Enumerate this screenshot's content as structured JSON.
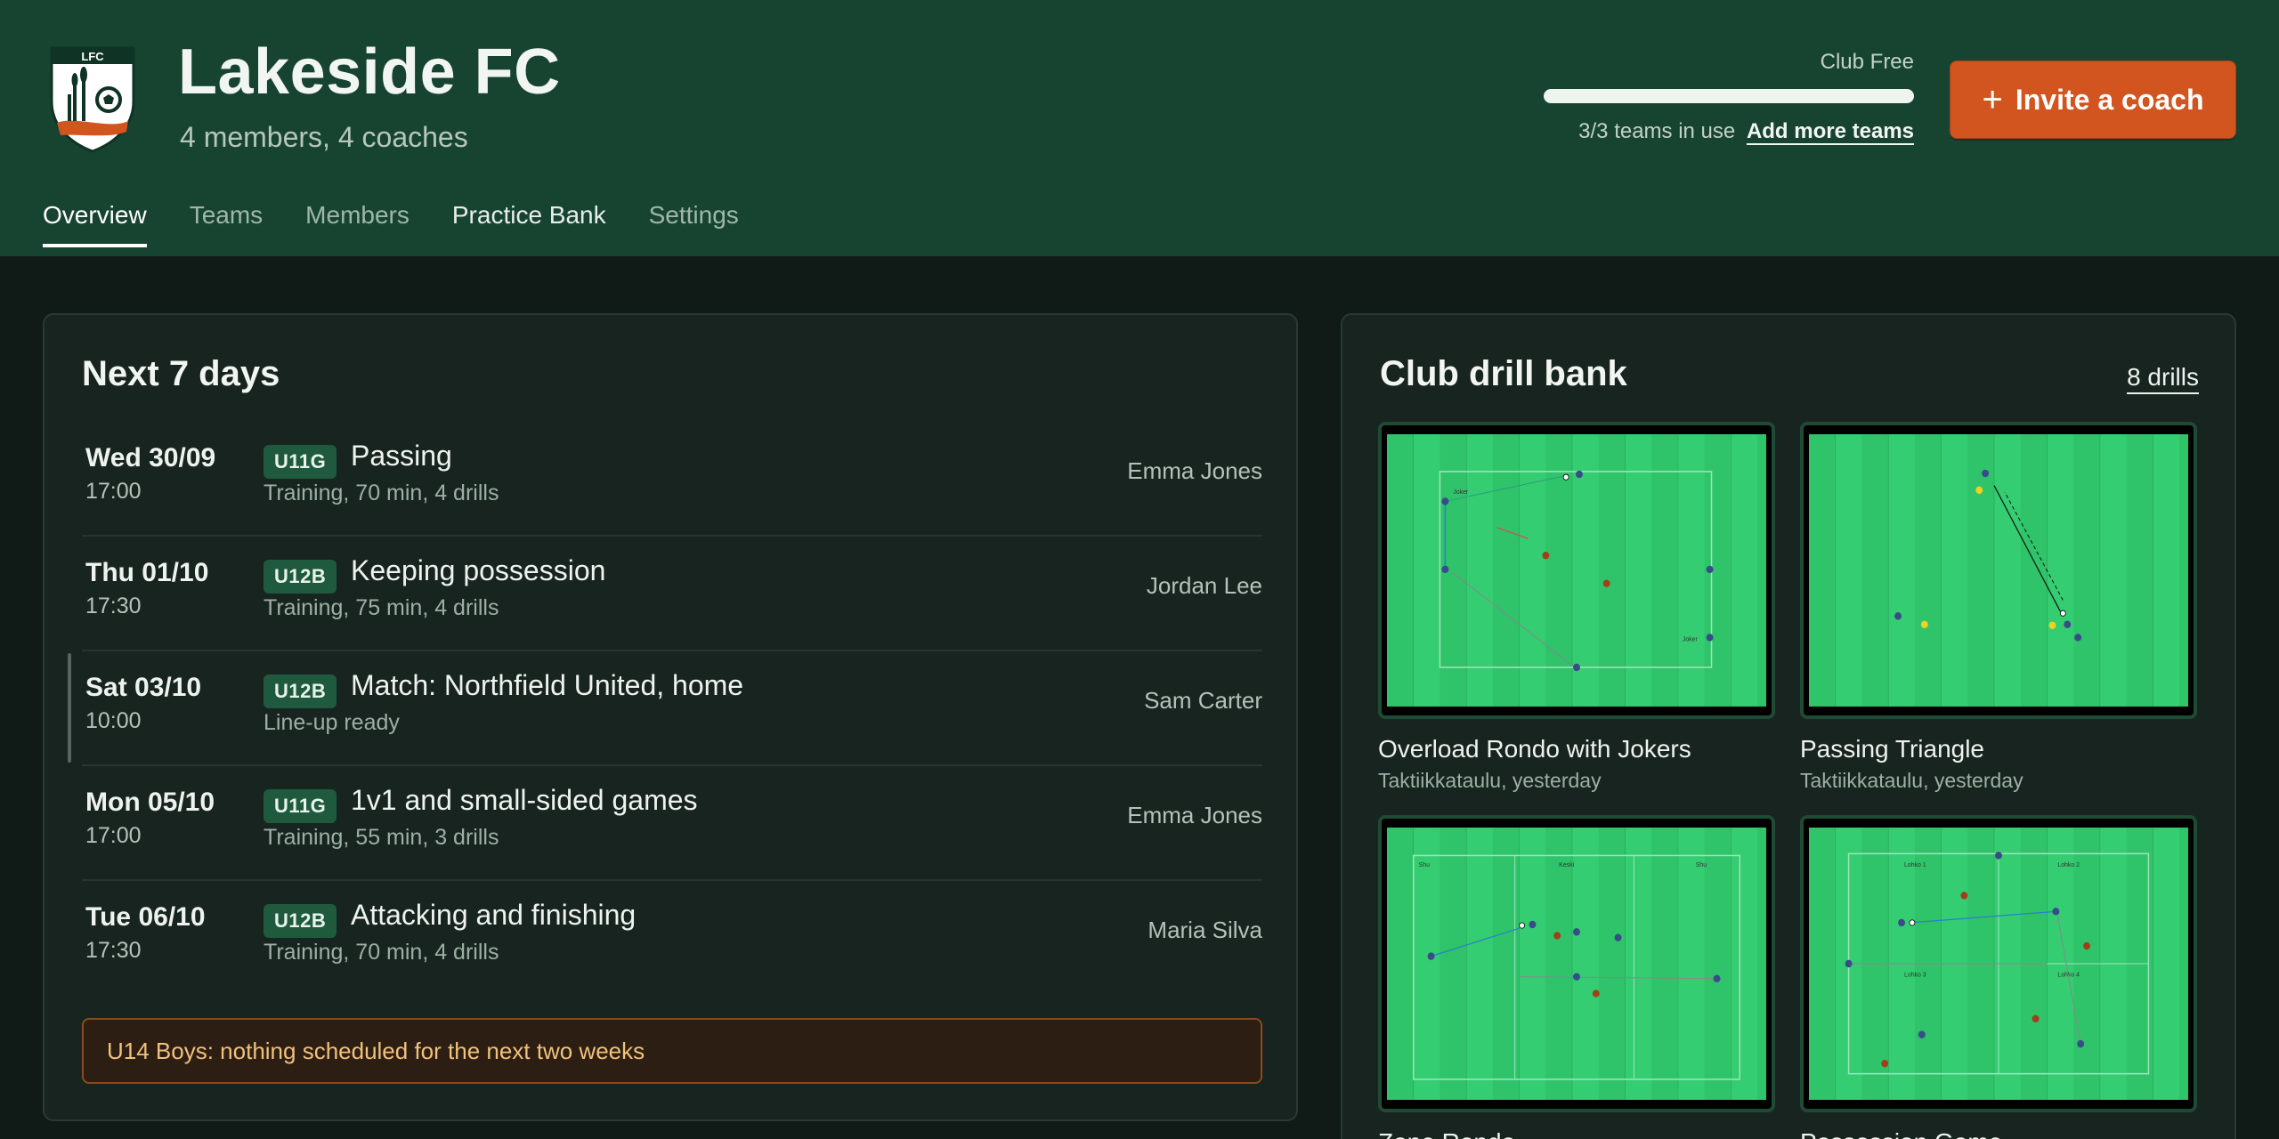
{
  "club": {
    "logo_text": "LFC",
    "name": "Lakeside FC",
    "subtitle": "4 members, 4 coaches"
  },
  "plan": {
    "name": "Club Free",
    "usage_text": "3/3 teams in use",
    "usage_fraction": 1.0,
    "add_link": "Add more teams"
  },
  "invite_button": {
    "icon": "plus-icon",
    "label": "Invite a coach"
  },
  "tabs": [
    {
      "label": "Overview",
      "active": true
    },
    {
      "label": "Teams"
    },
    {
      "label": "Members"
    },
    {
      "label": "Practice Bank"
    },
    {
      "label": "Settings"
    }
  ],
  "schedule": {
    "title": "Next 7 days",
    "events": [
      {
        "date": "Wed 30/09",
        "time": "17:00",
        "team": "U11G",
        "title": "Passing",
        "detail": "Training, 70 min, 4 drills",
        "coach": "Emma Jones"
      },
      {
        "date": "Thu 01/10",
        "time": "17:30",
        "team": "U12B",
        "title": "Keeping possession",
        "detail": "Training, 75 min, 4 drills",
        "coach": "Jordan Lee"
      },
      {
        "date": "Sat 03/10",
        "time": "10:00",
        "team": "U12B",
        "title": "Match: Northfield United, home",
        "detail": "Line-up ready",
        "coach": "Sam Carter"
      },
      {
        "date": "Mon 05/10",
        "time": "17:00",
        "team": "U11G",
        "title": "1v1 and small-sided games",
        "detail": "Training, 55 min, 3 drills",
        "coach": "Emma Jones"
      },
      {
        "date": "Tue 06/10",
        "time": "17:30",
        "team": "U12B",
        "title": "Attacking and finishing",
        "detail": "Training, 70 min, 4 drills",
        "coach": "Maria Silva"
      }
    ],
    "warning": "U14 Boys: nothing scheduled for the next two weeks"
  },
  "drill_bank": {
    "title": "Club drill bank",
    "count_label": "8 drills",
    "drills": [
      {
        "name": "Overload Rondo with Jokers",
        "meta": "Taktiikkataulu, yesterday",
        "labels": [
          "Joker",
          "Joker"
        ]
      },
      {
        "name": "Passing Triangle",
        "meta": "Taktiikkataulu, yesterday"
      },
      {
        "name": "Zone Rondo",
        "meta": "",
        "labels": [
          "Shu",
          "Keski",
          "Shu"
        ]
      },
      {
        "name": "Possession Game",
        "meta": "",
        "labels": [
          "Lohko 1",
          "Lohko 2",
          "Lohko 3",
          "Lohko 4"
        ]
      }
    ]
  }
}
